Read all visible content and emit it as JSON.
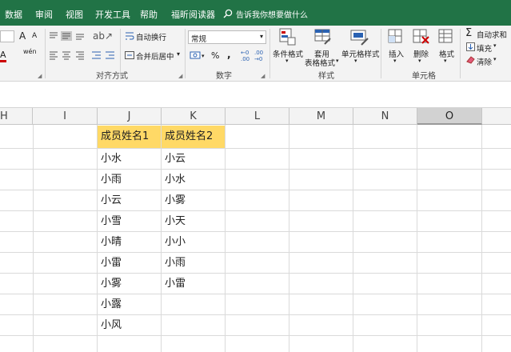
{
  "tabs": {
    "items": [
      "数据",
      "审阅",
      "视图",
      "开发工具",
      "帮助",
      "福昕阅读器"
    ],
    "tell_me": "告诉我你想要做什么"
  },
  "ribbon": {
    "font": {
      "increase": "A",
      "decrease": "A",
      "color_a": "A",
      "phonetic": "wén"
    },
    "alignment": {
      "wrap_text": "自动换行",
      "merge_center": "合并后居中",
      "group_label": "对齐方式"
    },
    "number": {
      "format_value": "常规",
      "percent": "%",
      "comma": ",",
      "group_label": "数字"
    },
    "styles": {
      "conditional": "条件格式",
      "table_format_1": "套用",
      "table_format_2": "表格格式",
      "cell_styles": "单元格样式",
      "group_label": "样式"
    },
    "cells": {
      "insert": "插入",
      "delete": "删除",
      "format": "格式",
      "group_label": "单元格"
    },
    "editing": {
      "autosum": "自动求和",
      "fill": "填充",
      "clear": "清除"
    }
  },
  "columns": [
    "H",
    "I",
    "J",
    "K",
    "L",
    "M",
    "N",
    "O"
  ],
  "selected_column": "O",
  "sheet": {
    "header_j": "成员姓名1",
    "header_k": "成员姓名2",
    "col_j": [
      "小水",
      "小雨",
      "小云",
      "小雪",
      "小晴",
      "小雷",
      "小雾",
      "小露",
      "小风"
    ],
    "col_k": [
      "小云",
      "小水",
      "小雾",
      "小天",
      "小小",
      "小雨",
      "小雷"
    ]
  },
  "colors": {
    "ribbon_tab": "#217346",
    "header_fill": "#ffd966"
  }
}
